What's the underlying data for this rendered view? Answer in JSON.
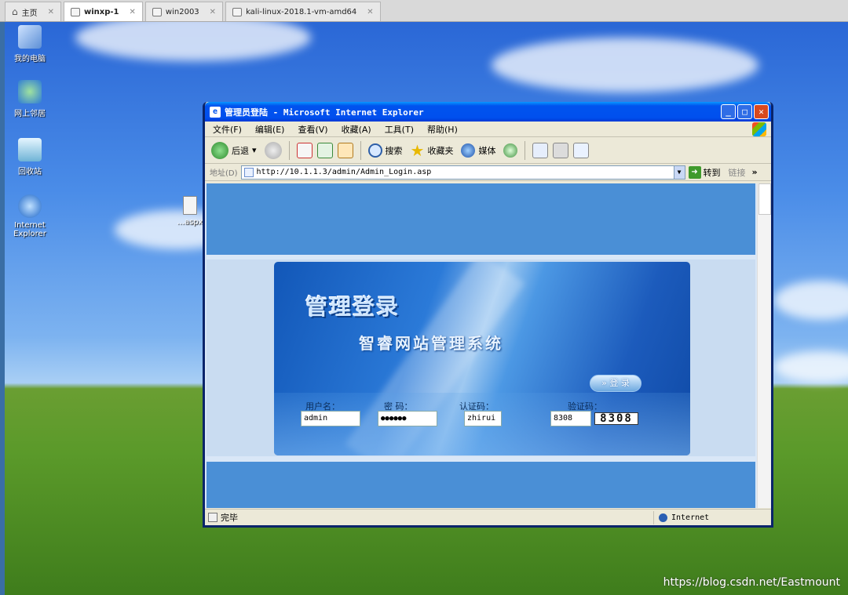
{
  "host_tabs": [
    {
      "label": "主页",
      "active": false
    },
    {
      "label": "winxp-1",
      "active": true
    },
    {
      "label": "win2003",
      "active": false
    },
    {
      "label": "kali-linux-2018.1-vm-amd64",
      "active": false
    }
  ],
  "desktop": {
    "icons": [
      "我的电脑",
      "网上邻居",
      "回收站",
      "Internet Explorer"
    ],
    "file_label": "...aspx",
    "watermark": "https://blog.csdn.net/Eastmount"
  },
  "ie": {
    "title": "管理员登陆 - Microsoft Internet Explorer",
    "menu": [
      "文件(F)",
      "编辑(E)",
      "查看(V)",
      "收藏(A)",
      "工具(T)",
      "帮助(H)"
    ],
    "toolbar": {
      "back": "后退",
      "search": "搜索",
      "favorites": "收藏夹",
      "media": "媒体"
    },
    "address_label": "地址(D)",
    "url": "http://10.1.1.3/admin/Admin_Login.asp",
    "go_label": "转到",
    "links_label": "链接",
    "status_text": "完毕",
    "status_zone": "Internet"
  },
  "login": {
    "title": "管理登录",
    "system_name": "智睿网站管理系统",
    "login_button": "» 登 录",
    "fields": {
      "username_label": "用户名：",
      "username_value": "admin",
      "password_label": "密 码：",
      "password_value": "●●●●●●",
      "authcode_label": "认证码：",
      "authcode_value": "zhirui",
      "captcha_label": "验证码：",
      "captcha_value": "8308",
      "captcha_image_text": "8308"
    }
  }
}
